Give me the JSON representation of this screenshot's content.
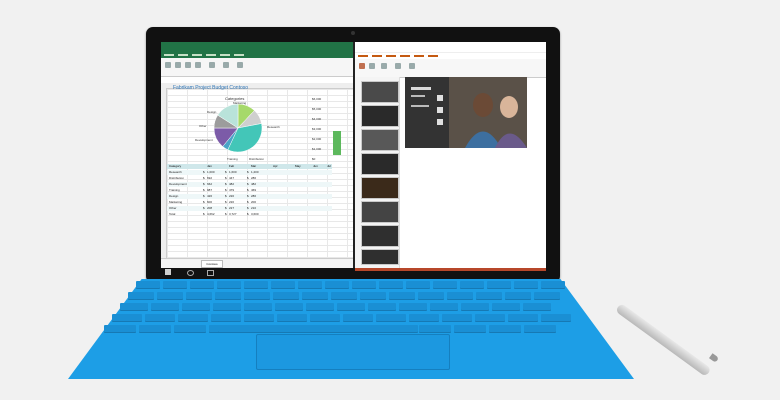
{
  "excel": {
    "workbook_title": "Fabrikam Project Budget Contoso",
    "chart_title": "Categories",
    "pie_labels": [
      "Marketing",
      "Design",
      "Research",
      "Other",
      "Development",
      "Training",
      "Distribution"
    ],
    "pie_values": [
      12,
      10,
      35,
      4,
      14,
      9,
      16
    ],
    "pie_colors": [
      "#a6d96a",
      "#cfcfcf",
      "#43c6b8",
      "#4aa3c7",
      "#7c5ba8",
      "#9c9c9c",
      "#b9e3da"
    ],
    "y_values": [
      "$6,000",
      "$5,000",
      "$4,000",
      "$3,000",
      "$2,000",
      "$1,000",
      "$0"
    ],
    "table_header": [
      "Category",
      "Jan",
      "Feb",
      "Mar",
      "Apr",
      "May",
      "Jun",
      "Jul"
    ],
    "table_rows": [
      [
        "Research",
        "$",
        "1,000",
        "$",
        "1,600",
        "$",
        "1,200"
      ],
      [
        "Distribution",
        "$",
        "692",
        "$",
        "447",
        "$",
        "286"
      ],
      [
        "Development",
        "$",
        "662",
        "$",
        "482",
        "$",
        "482"
      ],
      [
        "Training",
        "$",
        "987",
        "$",
        "479",
        "$",
        "469"
      ],
      [
        "Design",
        "$",
        "426",
        "$",
        "220",
        "$",
        "286"
      ],
      [
        "Marketing",
        "$",
        "600",
        "$",
        "220",
        "$",
        "200"
      ],
      [
        "Other",
        "$",
        "208",
        "$",
        "227",
        "$",
        "210"
      ],
      [
        "Total",
        "$",
        "4,662",
        "$",
        "3,727",
        "$",
        "3,600"
      ]
    ],
    "sheet_tab": "Contoso"
  }
}
